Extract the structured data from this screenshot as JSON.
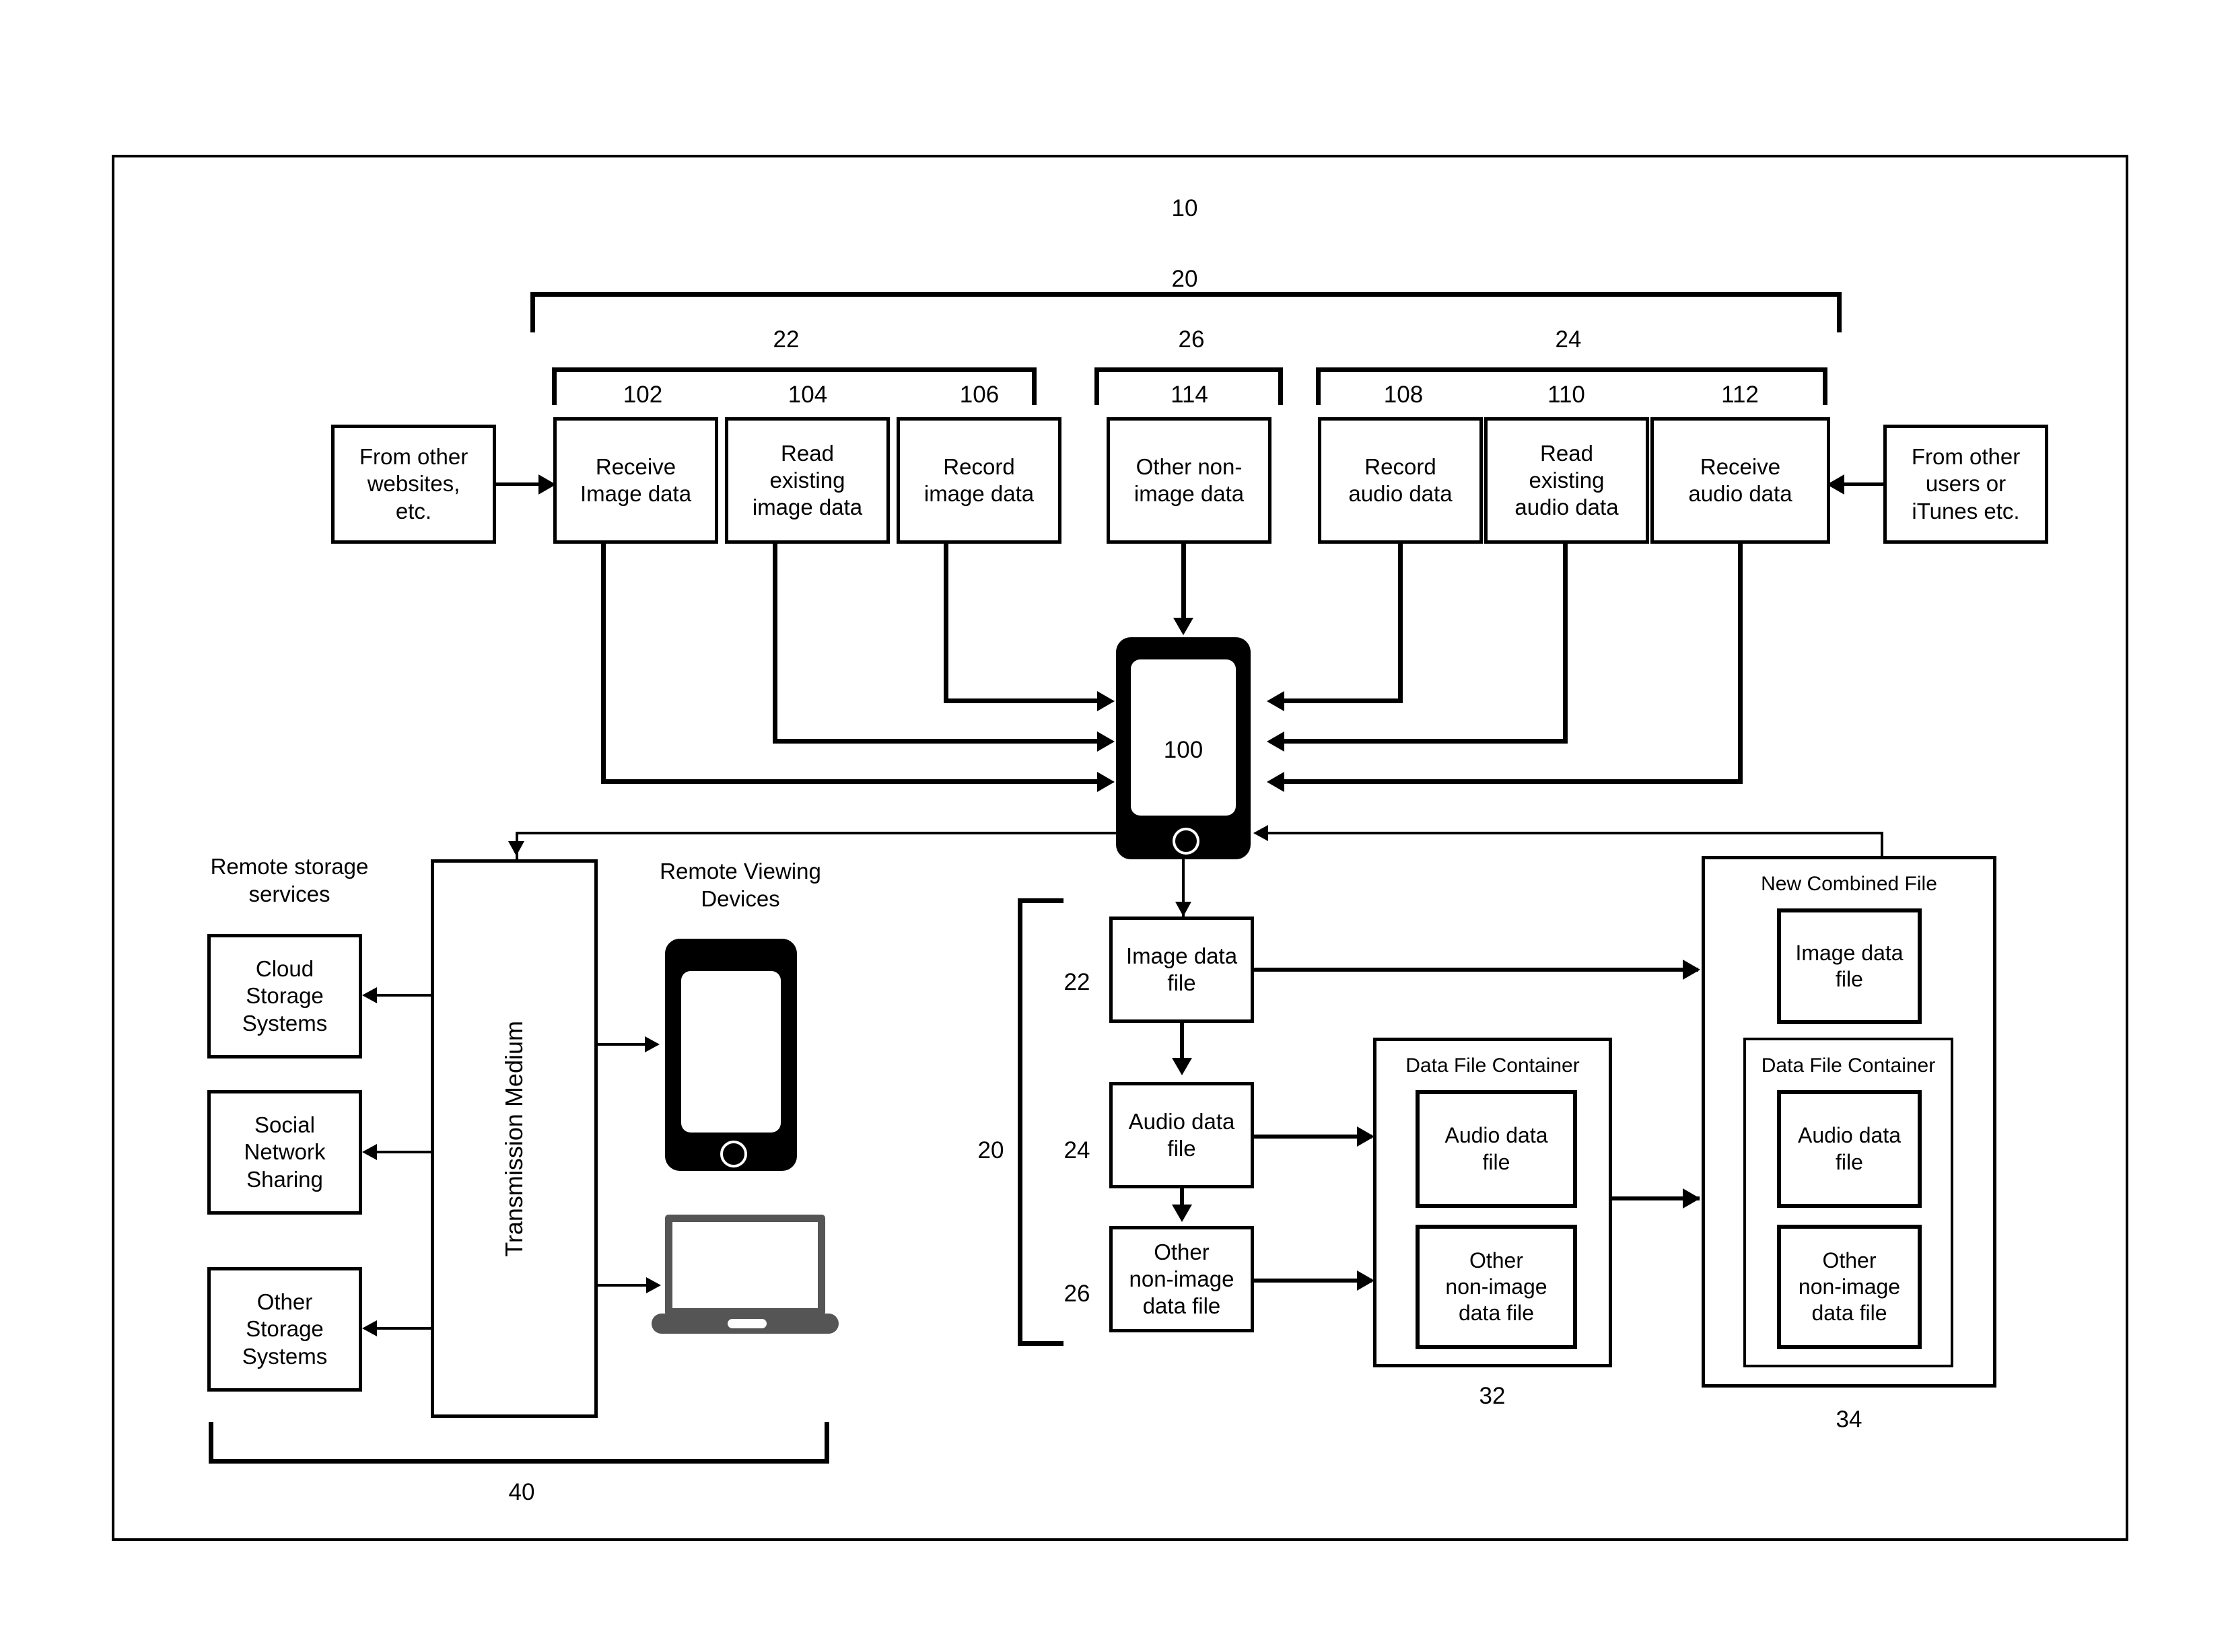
{
  "figure": {
    "root_label": "10",
    "group_20_label": "20",
    "group_22_label": "22",
    "group_24_label": "24",
    "group_26_label": "26",
    "device_label": "100"
  },
  "sources": {
    "from_websites": "From other\nwebsites,\netc.",
    "from_users": "From other\nusers or\niTunes etc."
  },
  "capture_boxes": [
    {
      "num": "102",
      "label": "Receive\nImage data"
    },
    {
      "num": "104",
      "label": "Read\nexisting\nimage data"
    },
    {
      "num": "106",
      "label": "Record\nimage data"
    },
    {
      "num": "114",
      "label": "Other non-\nimage data"
    },
    {
      "num": "108",
      "label": "Record\naudio data"
    },
    {
      "num": "110",
      "label": "Read\nexisting\naudio data"
    },
    {
      "num": "112",
      "label": "Receive\naudio data"
    }
  ],
  "remote": {
    "storage_title": "Remote storage\nservices",
    "viewing_title": "Remote Viewing\nDevices",
    "transmission_medium": "Transmission Medium",
    "storage_services": [
      "Cloud\nStorage\nSystems",
      "Social\nNetwork\nSharing",
      "Other\nStorage\nSystems"
    ],
    "bracket_label": "40"
  },
  "files": {
    "group_label": "20",
    "image_num": "22",
    "audio_num": "24",
    "other_num": "26",
    "image_file": "Image data\nfile",
    "audio_file": "Audio data\nfile",
    "other_file": "Other\nnon-image\ndata file"
  },
  "container": {
    "title": "Data File Container",
    "num": "32",
    "audio_file": "Audio data\nfile",
    "other_file": "Other\nnon-image\ndata file"
  },
  "combined": {
    "title": "New Combined File",
    "num": "34",
    "image_file": "Image data\nfile",
    "container_title": "Data File Container",
    "audio_file": "Audio data\nfile",
    "other_file": "Other\nnon-image\ndata file"
  },
  "colors": {
    "line": "#000000",
    "device_body": "#000000",
    "laptop": "#555555"
  }
}
